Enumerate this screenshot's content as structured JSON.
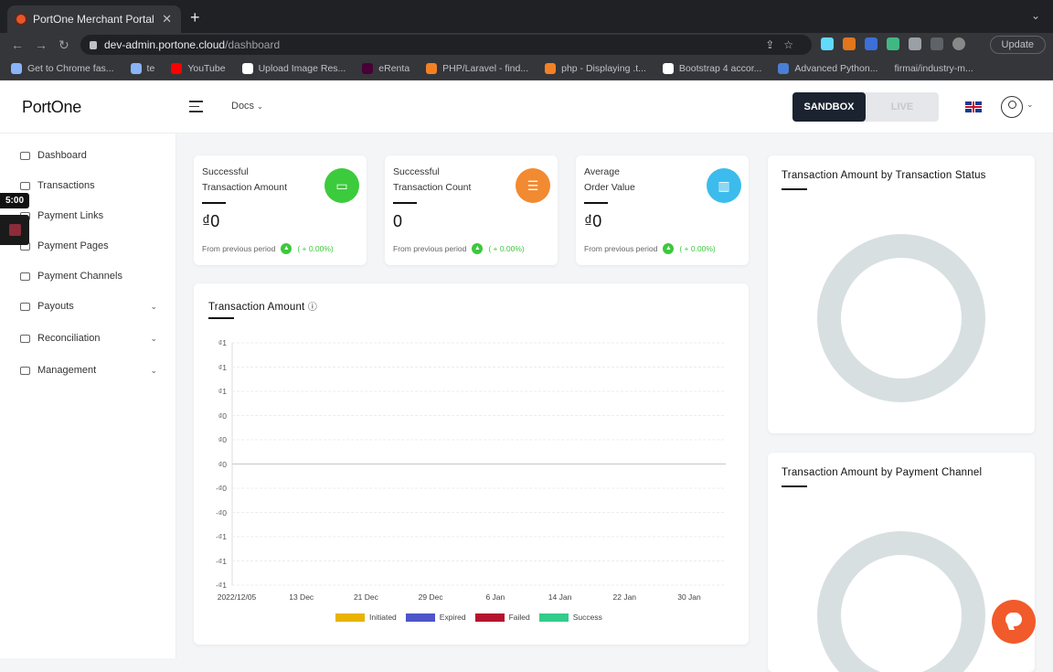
{
  "browser": {
    "tab_title": "PortOne Merchant Portal",
    "url_host": "dev-admin.portone.cloud",
    "url_path": "/dashboard",
    "update_label": "Update",
    "bookmarks": [
      "Get to Chrome fas...",
      "te",
      "YouTube",
      "Upload Image Res...",
      "eRenta",
      "PHP/Laravel - find...",
      "php - Displaying .t...",
      "Bootstrap 4 accor...",
      "Advanced Python...",
      "firmai/industry-m..."
    ]
  },
  "header": {
    "logo": "PortOne",
    "docs_label": "Docs",
    "sandbox_label": "SANDBOX",
    "live_label": "LIVE"
  },
  "sidebar": {
    "items": [
      {
        "label": "Dashboard"
      },
      {
        "label": "Transactions"
      },
      {
        "label": "Payment Links"
      },
      {
        "label": "Payment Pages"
      },
      {
        "label": "Payment Channels"
      },
      {
        "label": "Payouts"
      },
      {
        "label": "Reconciliation"
      },
      {
        "label": "Management"
      }
    ]
  },
  "recorder": {
    "timer": "5:00"
  },
  "stats": [
    {
      "line1": "Successful",
      "line2": "Transaction Amount",
      "value": "₫0",
      "footer": "From previous period",
      "change": "( + 0.00%)",
      "color": "#3ccb3c"
    },
    {
      "line1": "Successful",
      "line2": "Transaction Count",
      "value": "0",
      "footer": "From previous period",
      "change": "( + 0.00%)",
      "color": "#f28a31"
    },
    {
      "line1": "Average",
      "line2": "Order Value",
      "value": "₫0",
      "footer": "From previous period",
      "change": "( + 0.00%)",
      "color": "#3cbcec"
    }
  ],
  "charts": {
    "status_title": "Transaction Amount by Transaction Status",
    "channel_title": "Transaction Amount by Payment Channel"
  },
  "chart_data": {
    "type": "line",
    "title": "Transaction Amount",
    "y_tick_labels": [
      "₫1",
      "₫1",
      "₫1",
      "₫0",
      "₫0",
      "₫0",
      "-₫0",
      "-₫0",
      "-₫1",
      "-₫1",
      "-₫1"
    ],
    "x_tick_labels": [
      "2022/12/05",
      "13 Dec",
      "21 Dec",
      "29 Dec",
      "6 Jan",
      "14 Jan",
      "22 Jan",
      "30 Jan"
    ],
    "series": [
      {
        "name": "Initiated",
        "color": "#e8b400",
        "values": []
      },
      {
        "name": "Expired",
        "color": "#4d55c8",
        "values": []
      },
      {
        "name": "Failed",
        "color": "#b5142e",
        "values": []
      },
      {
        "name": "Success",
        "color": "#33cc8a",
        "values": []
      }
    ],
    "grid": true,
    "legend": "bottom"
  }
}
